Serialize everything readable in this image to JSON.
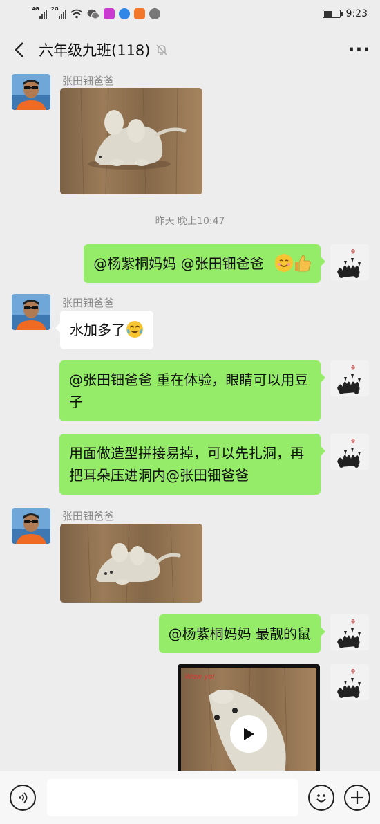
{
  "status_bar": {
    "network_1": "4G",
    "network_2": "2G",
    "time": "9:23",
    "battery_level": 0.55
  },
  "header": {
    "title": "六年级九班(118)",
    "back_icon": "chevron-left-icon",
    "mute_icon": "bell-off-icon",
    "more_icon": "more-dots-icon"
  },
  "messages": [
    {
      "type": "image",
      "sender": "张田钿爸爸",
      "side": "left",
      "image": "clay-mouse-photo"
    },
    {
      "type": "timestamp",
      "text": "昨天 晚上10:47"
    },
    {
      "type": "text",
      "side": "right",
      "text": "@杨紫桐妈妈  @张田钿爸爸 "
    },
    {
      "type": "text",
      "sender": "张田钿爸爸",
      "side": "left",
      "text": "水加多了"
    },
    {
      "type": "text",
      "side": "right",
      "text": "@张田钿爸爸  重在体验，眼睛可以用豆子"
    },
    {
      "type": "text",
      "side": "right",
      "text": "用面做造型拼接易掉，可以先扎洞，再把耳朵压进洞内@张田钿爸爸"
    },
    {
      "type": "image",
      "sender": "张田钿爸爸",
      "side": "left",
      "image": "clay-mouse-photo"
    },
    {
      "type": "text",
      "side": "right",
      "text": "@杨紫桐妈妈  最靓的鼠"
    },
    {
      "type": "video",
      "side": "right",
      "image": "clay-mouse-video",
      "watermark": "Wow yo!"
    }
  ],
  "input_bar": {
    "voice_icon": "voice-icon",
    "emoji_icon": "emoji-icon",
    "plus_icon": "plus-icon",
    "value": ""
  },
  "colors": {
    "background": "#ededed",
    "my_bubble": "#95ec69",
    "other_bubble": "#ffffff",
    "muted_text": "#8a8a8a"
  }
}
